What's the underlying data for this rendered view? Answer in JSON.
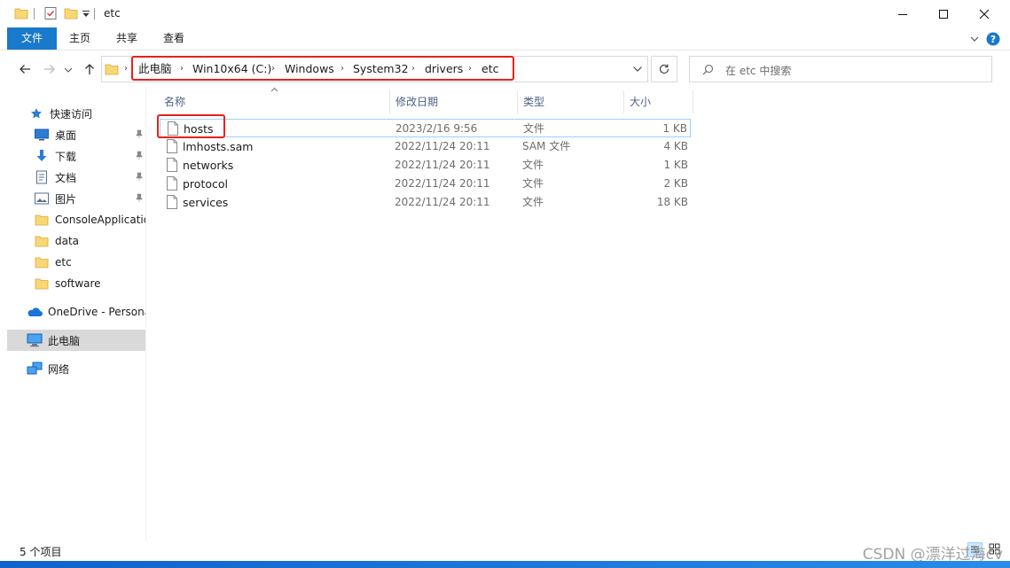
{
  "window": {
    "title": "etc"
  },
  "ribbon": {
    "tabs": [
      "文件",
      "主页",
      "共享",
      "查看"
    ]
  },
  "address": {
    "crumbs": [
      "此电脑",
      "Win10x64 (C:)",
      "Windows",
      "System32",
      "drivers",
      "etc"
    ],
    "search_placeholder": "在 etc 中搜索"
  },
  "nav": {
    "quick_access": "快速访问",
    "pinned": [
      "桌面",
      "下载",
      "文档",
      "图片"
    ],
    "folders": [
      "ConsoleApplication",
      "data",
      "etc",
      "software"
    ],
    "onedrive": "OneDrive - Personal",
    "this_pc": "此电脑",
    "network": "网络"
  },
  "columns": {
    "name": "名称",
    "date": "修改日期",
    "type": "类型",
    "size": "大小"
  },
  "files": [
    {
      "name": "hosts",
      "date": "2023/2/16 9:56",
      "type": "文件",
      "size": "1 KB"
    },
    {
      "name": "lmhosts.sam",
      "date": "2022/11/24 20:11",
      "type": "SAM 文件",
      "size": "4 KB"
    },
    {
      "name": "networks",
      "date": "2022/11/24 20:11",
      "type": "文件",
      "size": "1 KB"
    },
    {
      "name": "protocol",
      "date": "2022/11/24 20:11",
      "type": "文件",
      "size": "2 KB"
    },
    {
      "name": "services",
      "date": "2022/11/24 20:11",
      "type": "文件",
      "size": "18 KB"
    }
  ],
  "status": {
    "count": "5 个项目"
  },
  "watermark": "CSDN @漂洋过海cv",
  "colors": {
    "accent": "#1979ca",
    "highlight_box": "#e8201c",
    "selection_border": "#99d1ff",
    "folder": "#f8d775"
  }
}
